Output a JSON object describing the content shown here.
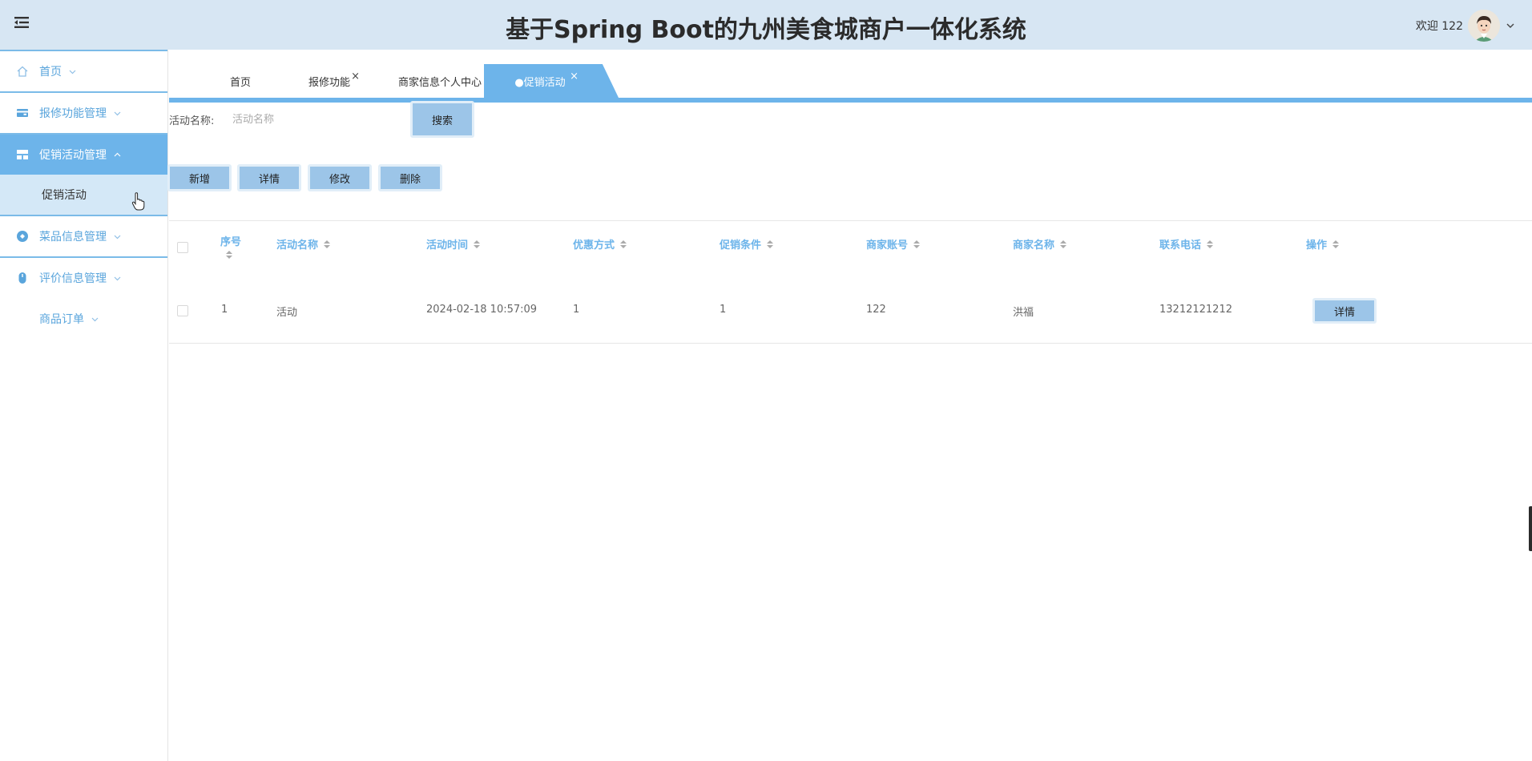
{
  "header": {
    "title": "基于Spring Boot的九州美食城商户一体化系统",
    "welcome": "欢迎 122",
    "menu_icon": "hamburger-menu-icon",
    "avatar_icon": "user-avatar-icon"
  },
  "sidebar": {
    "items": [
      {
        "label": "首页",
        "icon": "home-icon"
      },
      {
        "label": "报修功能管理",
        "icon": "wallet-icon"
      },
      {
        "label": "促销活动管理",
        "icon": "layout-icon",
        "active": true
      },
      {
        "label": "菜品信息管理",
        "icon": "dish-icon"
      },
      {
        "label": "评价信息管理",
        "icon": "mouse-icon"
      },
      {
        "label": "商品订单",
        "icon": "none"
      }
    ],
    "sub_items": [
      {
        "label": "促销活动"
      }
    ]
  },
  "tabs": [
    {
      "label": "首页",
      "closable": false
    },
    {
      "label": "报修功能",
      "closable": true
    },
    {
      "label": "商家信息个人中心",
      "closable": false
    },
    {
      "label": "●促销活动",
      "closable": true,
      "active": true
    }
  ],
  "tab_close_glyph": "×",
  "search": {
    "label": "活动名称:",
    "placeholder": "活动名称",
    "value": "",
    "button": "搜索"
  },
  "actions": {
    "add": "新增",
    "detail": "详情",
    "edit": "修改",
    "delete": "删除"
  },
  "table": {
    "columns": [
      "序号",
      "活动名称",
      "活动时间",
      "优惠方式",
      "促销条件",
      "商家账号",
      "商家名称",
      "联系电话",
      "操作"
    ],
    "rows": [
      {
        "index": "1",
        "name": "活动",
        "time": "2024-02-18 10:57:09",
        "discount": "1",
        "condition": "1",
        "account": "122",
        "merchant": "洪福",
        "phone": "13212121212",
        "action": "详情"
      }
    ]
  },
  "colors": {
    "header_bg": "#d7e6f3",
    "accent": "#6db4ea",
    "button_bg": "#9cc5e8",
    "submenu_bg": "#d4e8f7"
  }
}
